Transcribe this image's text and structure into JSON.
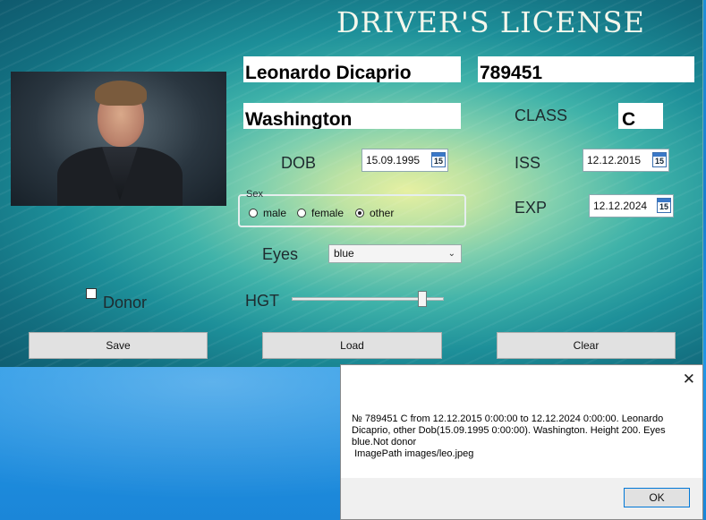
{
  "window": {
    "title": "DRIVER'S LICENSE"
  },
  "fields": {
    "name": "Leonardo Dicaprio",
    "number": "789451",
    "state": "Washington",
    "class_label": "CLASS",
    "class_value": "C",
    "dob_label": "DOB",
    "dob_value": "15.09.1995",
    "iss_label": "ISS",
    "iss_value": "12.12.2015",
    "exp_label": "EXP",
    "exp_value": "12.12.2024",
    "calendar_day": "15"
  },
  "sex": {
    "legend": "Sex",
    "options": [
      "male",
      "female",
      "other"
    ],
    "selected": "other"
  },
  "eyes": {
    "label": "Eyes",
    "selected": "blue",
    "arrow": "⌄"
  },
  "donor": {
    "label": "Donor",
    "checked": false
  },
  "height": {
    "label": "HGT",
    "slider_fraction": 0.88
  },
  "buttons": {
    "save": "Save",
    "load": "Load",
    "clear": "Clear"
  },
  "message_box": {
    "close_glyph": "✕",
    "text": "№ 789451 C from 12.12.2015 0:00:00 to 12.12.2024 0:00:00. Leonardo Dicaprio, other Dob(15.09.1995 0:00:00). Washington. Height 200. Eyes blue.Not donor\n ImagePath images/leo.jpeg",
    "ok": "OK"
  },
  "colors": {
    "title_text": "#f4f7ec",
    "button_bg": "#e1e1e1",
    "ok_border": "#0078d7"
  }
}
